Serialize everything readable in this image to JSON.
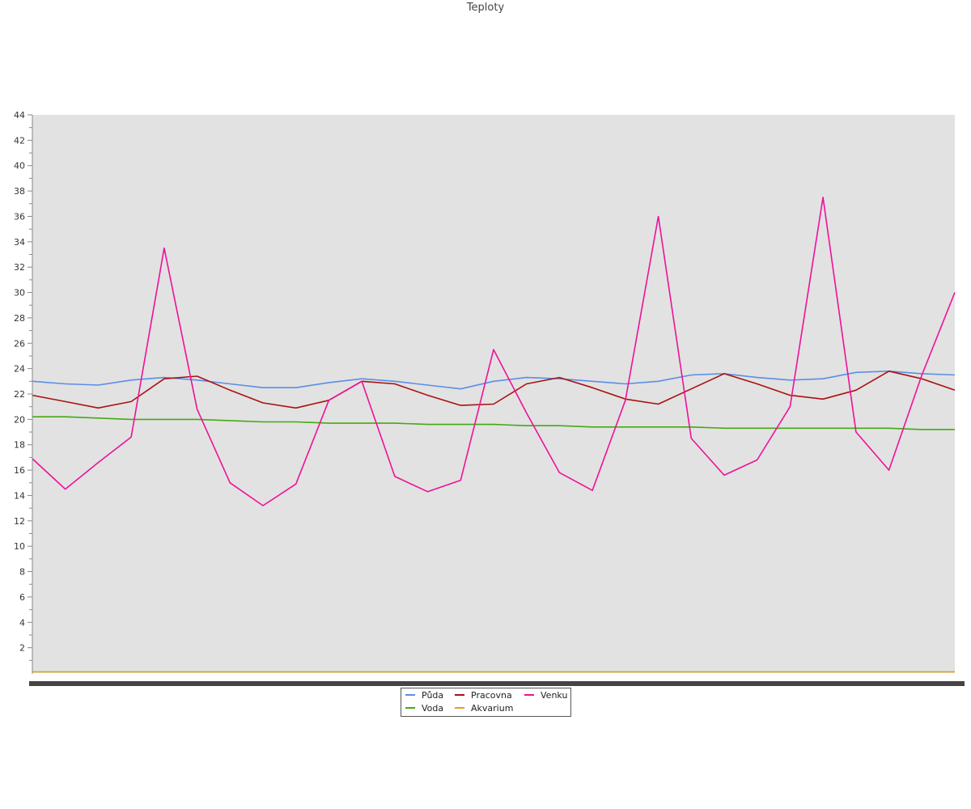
{
  "chart_data": {
    "type": "line",
    "title": "Teploty",
    "xlabel": "",
    "ylabel": "",
    "ylim": [
      0,
      44
    ],
    "y_ticks": [
      2,
      4,
      6,
      8,
      10,
      12,
      14,
      16,
      18,
      20,
      22,
      24,
      26,
      28,
      30,
      32,
      34,
      36,
      38,
      40,
      42,
      44
    ],
    "grid": false,
    "legend_position": "bottom-center",
    "x": [
      0,
      6,
      12,
      18,
      24,
      30,
      36,
      42,
      48,
      54,
      60,
      66,
      72,
      78,
      84,
      90,
      96,
      102,
      108,
      114,
      120,
      126,
      132,
      138,
      144,
      150,
      156,
      162,
      168
    ],
    "series": [
      {
        "name": "Půda",
        "color": "#5b8ee6",
        "values": [
          23.0,
          22.8,
          22.7,
          23.1,
          23.3,
          23.1,
          22.8,
          22.5,
          22.5,
          22.9,
          23.2,
          23.0,
          22.7,
          22.4,
          23.0,
          23.3,
          23.2,
          23.0,
          22.8,
          23.0,
          23.5,
          23.6,
          23.3,
          23.1,
          23.2,
          23.7,
          23.8,
          23.6,
          23.5
        ]
      },
      {
        "name": "Voda",
        "color": "#44aa11",
        "values": [
          20.2,
          20.2,
          20.1,
          20.0,
          20.0,
          20.0,
          19.9,
          19.8,
          19.8,
          19.7,
          19.7,
          19.7,
          19.6,
          19.6,
          19.6,
          19.5,
          19.5,
          19.4,
          19.4,
          19.4,
          19.4,
          19.3,
          19.3,
          19.3,
          19.3,
          19.3,
          19.3,
          19.2,
          19.2
        ]
      },
      {
        "name": "Pracovna",
        "color": "#aa1111",
        "values": [
          21.9,
          21.4,
          20.9,
          21.4,
          23.2,
          23.4,
          22.3,
          21.3,
          20.9,
          21.5,
          23.0,
          22.8,
          21.9,
          21.1,
          21.2,
          22.8,
          23.3,
          22.5,
          21.6,
          21.2,
          22.4,
          23.6,
          22.8,
          21.9,
          21.6,
          22.3,
          23.8,
          23.2,
          22.3
        ]
      },
      {
        "name": "Akvarium",
        "color": "#e8a020",
        "values": [
          0.1,
          0.1,
          0.1,
          0.1,
          0.1,
          0.1,
          0.1,
          0.1,
          0.1,
          0.1,
          0.1,
          0.1,
          0.1,
          0.1,
          0.1,
          0.1,
          0.1,
          0.1,
          0.1,
          0.1,
          0.1,
          0.1,
          0.1,
          0.1,
          0.1,
          0.1,
          0.1,
          0.1,
          0.1
        ]
      },
      {
        "name": "Venku",
        "color": "#ee1199",
        "values": [
          16.9,
          14.5,
          16.6,
          18.6,
          33.5,
          20.8,
          15.0,
          13.2,
          14.9,
          21.5,
          23.0,
          15.5,
          14.3,
          15.2,
          25.5,
          20.5,
          15.8,
          14.4,
          21.5,
          36.0,
          18.5,
          15.6,
          16.8,
          21.0,
          37.5,
          19.0,
          16.0,
          23.5,
          30.0
        ]
      }
    ]
  }
}
